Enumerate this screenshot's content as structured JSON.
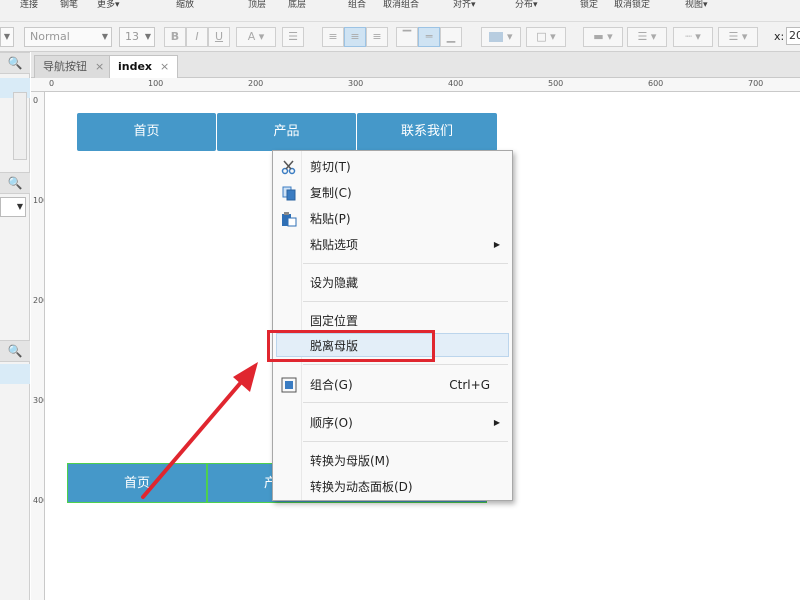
{
  "toolbar_top": {
    "items": [
      "连接",
      "钢笔",
      "更多▾",
      "缩放",
      "顶层",
      "底层",
      "组合",
      "取消组合",
      "对齐▾",
      "分布▾",
      "锁定",
      "取消锁定",
      "视图▾"
    ]
  },
  "format_bar": {
    "style_value": "Normal",
    "font_size": "13",
    "bold": "B",
    "italic": "I",
    "underline": "U",
    "font_color": "A",
    "x_label": "x:",
    "x_value": "20"
  },
  "tabs": [
    {
      "label": "导航按钮",
      "close": "×"
    },
    {
      "label": "index",
      "close": "×"
    }
  ],
  "ruler_h": [
    "0",
    "100",
    "200",
    "300",
    "400",
    "500",
    "600",
    "700"
  ],
  "ruler_v": [
    "0",
    "100",
    "200",
    "300",
    "400"
  ],
  "nav_top": [
    "首页",
    "产品",
    "联系我们"
  ],
  "nav_bottom": [
    "首页",
    "产"
  ],
  "context_menu": {
    "cut": "剪切(T)",
    "copy": "复制(C)",
    "paste": "粘贴(P)",
    "paste_options": "粘贴选项",
    "set_hidden": "设为隐藏",
    "fixed_position": "固定位置",
    "detach_master": "脱离母版",
    "group": "组合(G)",
    "group_shortcut": "Ctrl+G",
    "order": "顺序(O)",
    "convert_master": "转换为母版(M)",
    "convert_dynamic_panel": "转换为动态面板(D)"
  },
  "colors": {
    "nav_button": "#4598c9",
    "highlight_box": "#e0262f",
    "arrow": "#e0262f"
  }
}
